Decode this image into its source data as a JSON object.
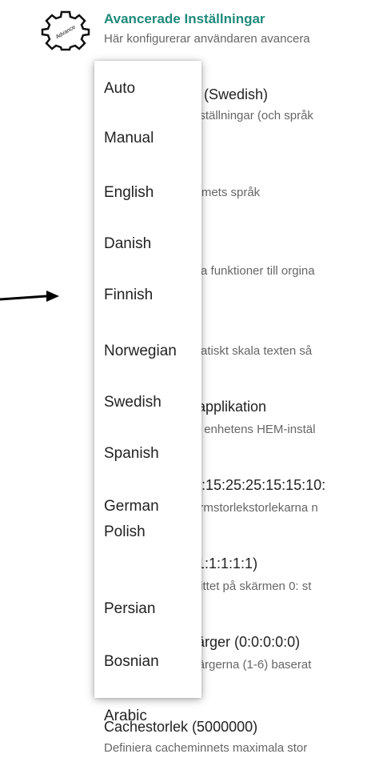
{
  "header": {
    "title": "Avancerade Inställningar",
    "subtitle": "Här konfigurerar användaren avancera",
    "icon": "gear-icon",
    "icon_label": "Advance"
  },
  "settings_rows": [
    {
      "title": "ats (Swedish)",
      "subtitle": "tsinställningar (och språk"
    },
    {
      "title": ":)",
      "subtitle": "rammets språk"
    },
    {
      "title": "",
      "subtitle": "lbara funktioner till orgina"
    },
    {
      "title": "xt",
      "subtitle": "tomatiskt skala texten så"
    },
    {
      "title": "m-applikation",
      "subtitle": "pna enhetens HEM-instäl"
    },
    {
      "title": "(15:15:25:25:15:15:10:",
      "subtitle": "skärmstorlekstorlekarna n"
    },
    {
      "title": ":1:1:1:1:1:1)",
      "subtitle": "psnittet på skärmen 0: st"
    },
    {
      "title": "n färger (0:0:0:0:0)",
      "subtitle": "rmfärgerna (1-6) baserat"
    }
  ],
  "last_row": {
    "title": "Cachestorlek (5000000)",
    "subtitle": "Definiera cacheminnets maximala stor"
  },
  "language_options": [
    "Auto",
    "Manual",
    "English",
    "Danish",
    "Finnish",
    "Norwegian",
    "Swedish",
    "Spanish",
    "German",
    "Polish",
    "Persian",
    "Bosnian",
    "Arabic"
  ],
  "colors": {
    "accent": "#1e8a7a",
    "text": "#222222",
    "subtext": "#666666"
  }
}
